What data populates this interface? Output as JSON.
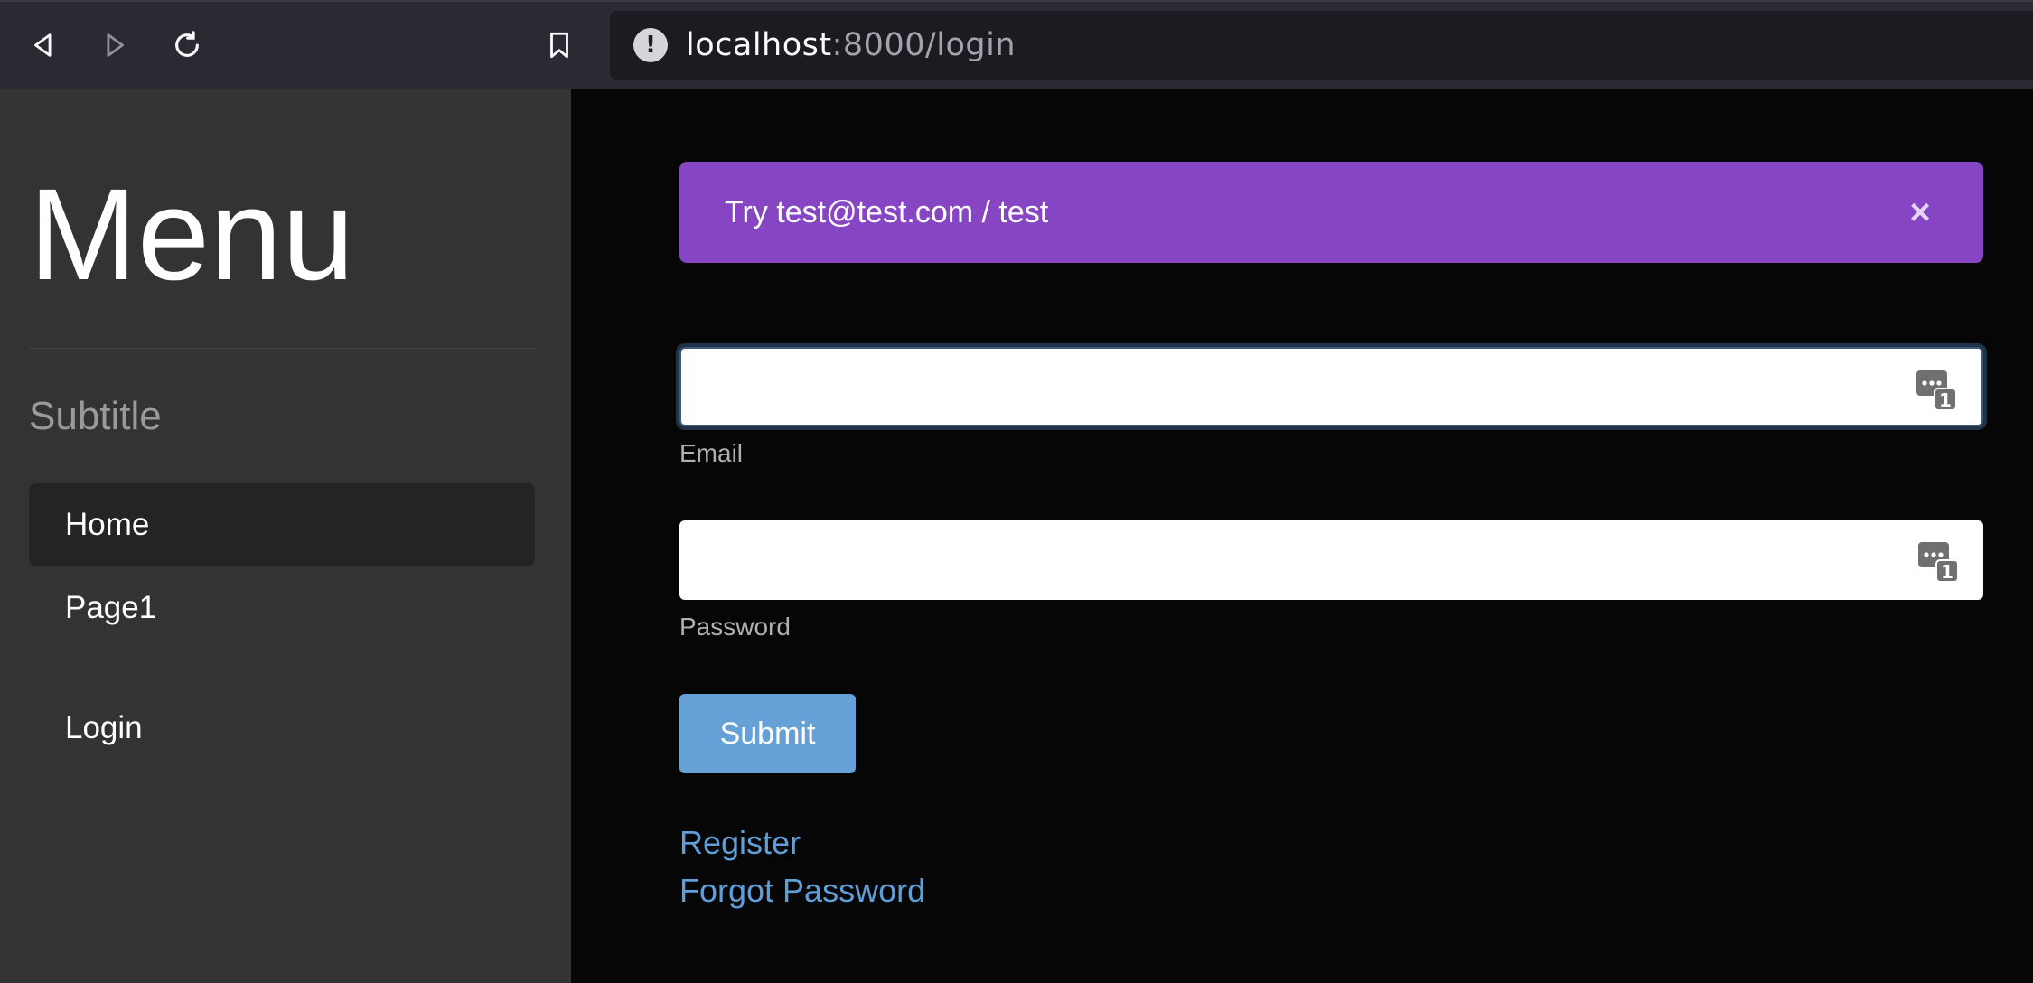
{
  "browser": {
    "url_host": "localhost",
    "url_rest": ":8000/login",
    "info_glyph": "!"
  },
  "sidebar": {
    "title": "Menu",
    "subtitle": "Subtitle",
    "items": [
      {
        "label": "Home",
        "active": true
      },
      {
        "label": "Page1",
        "active": false
      },
      {
        "label": "Login",
        "active": false
      }
    ]
  },
  "banner": {
    "text": "Try test@test.com / test",
    "close_glyph": "×",
    "color": "#8646c4"
  },
  "form": {
    "email_label": "Email",
    "email_value": "",
    "password_label": "Password",
    "password_value": "",
    "submit_label": "Submit",
    "submit_color": "#65a0d6"
  },
  "links": {
    "register": "Register",
    "forgot_password": "Forgot Password",
    "color": "#5f9fd9"
  }
}
